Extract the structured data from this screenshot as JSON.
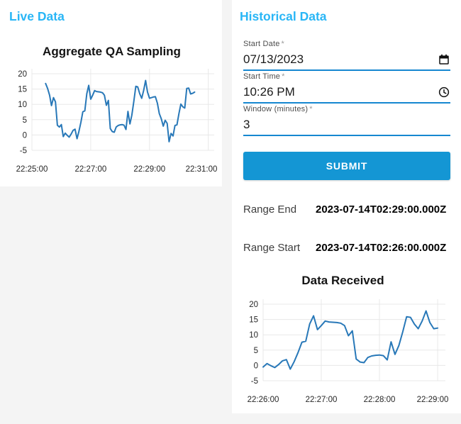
{
  "page": {
    "background": "#f4f4f4",
    "card_background": "#ffffff"
  },
  "colors": {
    "accent": "#29b6f6",
    "button": "#1496d4",
    "underline": "#1687d0",
    "line": "#2878b8",
    "grid": "#e8e8e8",
    "tick_text": "#262626"
  },
  "live_panel": {
    "title": "Live Data"
  },
  "historical_panel": {
    "title": "Historical Data",
    "fields": [
      {
        "label": "Start Date",
        "required_mark": "*",
        "value": "07/13/2023",
        "icon": "calendar-icon"
      },
      {
        "label": "Start Time",
        "required_mark": "*",
        "value": "10:26 PM",
        "icon": "clock-icon"
      },
      {
        "label": "Window (minutes)",
        "required_mark": "*",
        "value": "3",
        "icon": ""
      }
    ],
    "submit_label": "SUBMIT",
    "range_end": {
      "label": "Range End",
      "value": "2023-07-14T02:29:00.000Z"
    },
    "range_start": {
      "label": "Range Start",
      "value": "2023-07-14T02:26:00.000Z"
    }
  },
  "chart_data": [
    {
      "type": "line",
      "title": "Aggregate QA Sampling",
      "xlabel": "",
      "ylabel": "",
      "x_axis_start": "22:25:00",
      "x_range_seconds": 372,
      "x_ticks": [
        "22:25:00",
        "22:27:00",
        "22:29:00",
        "22:31:00"
      ],
      "y_ticks": [
        -5,
        0,
        5,
        10,
        15,
        20
      ],
      "x_start": "22:25:28",
      "step_seconds": 4,
      "values": [
        16.8,
        15.2,
        13.0,
        9.6,
        12.2,
        10.8,
        3.2,
        2.6,
        3.4,
        -0.5,
        0.6,
        -0.1,
        -0.7,
        0.3,
        1.5,
        1.9,
        -1.2,
        1.2,
        4.2,
        7.6,
        7.9,
        13.5,
        16.2,
        11.7,
        13.0,
        14.5,
        14.2,
        14.1,
        14.0,
        13.8,
        13.0,
        9.7,
        11.3,
        2.1,
        1.1,
        0.9,
        2.6,
        3.1,
        3.3,
        3.4,
        3.2,
        1.8,
        7.7,
        3.6,
        6.5,
        11.0,
        15.9,
        15.7,
        13.5,
        12.0,
        14.5,
        17.8,
        14.0,
        12.0,
        12.2,
        12.4,
        12.5,
        10.4,
        7.0,
        5.3,
        2.9,
        4.8,
        3.8,
        -2.2,
        0.5,
        -0.3,
        3.1,
        3.3,
        7.0,
        10.1,
        9.2,
        8.8,
        15.2,
        15.3,
        13.4,
        13.6,
        14.0
      ]
    },
    {
      "type": "line",
      "title": "Data Received",
      "xlabel": "",
      "ylabel": "",
      "x_axis_start": "22:26:00",
      "x_range_seconds": 188,
      "x_ticks": [
        "22:26:00",
        "22:27:00",
        "22:28:00",
        "22:29:00"
      ],
      "y_ticks": [
        -5,
        0,
        5,
        10,
        15,
        20
      ],
      "x_start": "22:26:00",
      "step_seconds": 4,
      "values": [
        -0.5,
        0.6,
        -0.1,
        -0.7,
        0.3,
        1.5,
        1.9,
        -1.2,
        1.2,
        4.2,
        7.6,
        7.9,
        13.5,
        16.2,
        11.7,
        13.0,
        14.5,
        14.2,
        14.1,
        14.0,
        13.8,
        13.0,
        9.7,
        11.3,
        2.1,
        1.1,
        0.9,
        2.6,
        3.1,
        3.3,
        3.4,
        3.2,
        1.8,
        7.7,
        3.6,
        6.5,
        11.0,
        15.9,
        15.7,
        13.5,
        12.0,
        14.5,
        17.8,
        14.0,
        12.0,
        12.2
      ]
    }
  ]
}
